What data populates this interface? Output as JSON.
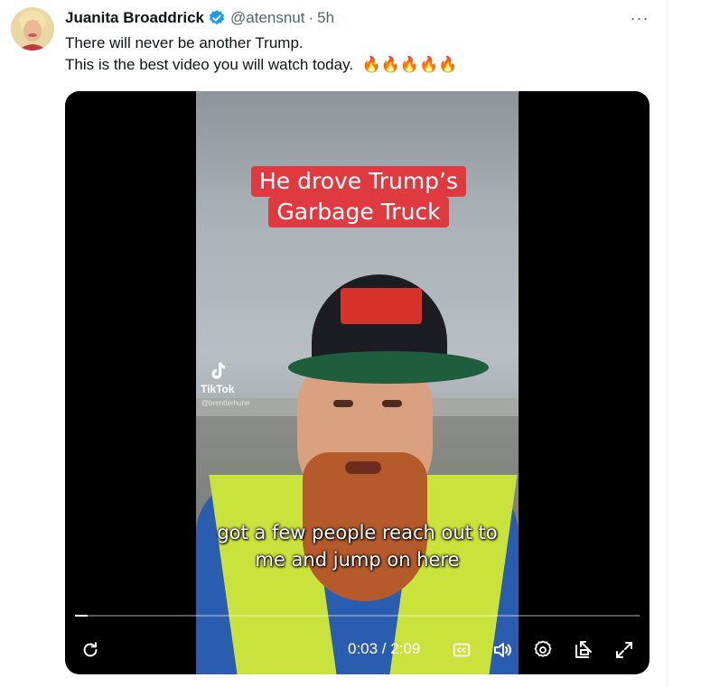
{
  "author": {
    "name": "Juanita Broaddrick",
    "handle": "@atensnut",
    "separator": "·",
    "time": "5h"
  },
  "more_label": "···",
  "tweet": {
    "line1": "There will never be another Trump.",
    "line2": "This is the best video you will watch today.",
    "emoji": "🔥🔥🔥🔥🔥"
  },
  "video": {
    "overlay_line1": "He drove Trump’s",
    "overlay_line2": "Garbage Truck",
    "caption": "got a few people reach out to me and jump on here",
    "watermark": "TikTok",
    "watermark_user": "@brentterhune",
    "current_time": "0:03",
    "duration": "2:09",
    "time_display": "0:03 / 2:09",
    "progress_fraction": 0.023
  },
  "icons": {
    "verified": "verified-badge-icon",
    "replay": "replay-icon",
    "captions": "closed-captions-icon",
    "volume": "volume-icon",
    "settings": "settings-icon",
    "popout": "popout-icon",
    "fullscreen": "fullscreen-icon"
  },
  "colors": {
    "verified_blue": "#1d9bf0",
    "overlay_red": "#de3a3f",
    "secondary_text": "#536471"
  }
}
